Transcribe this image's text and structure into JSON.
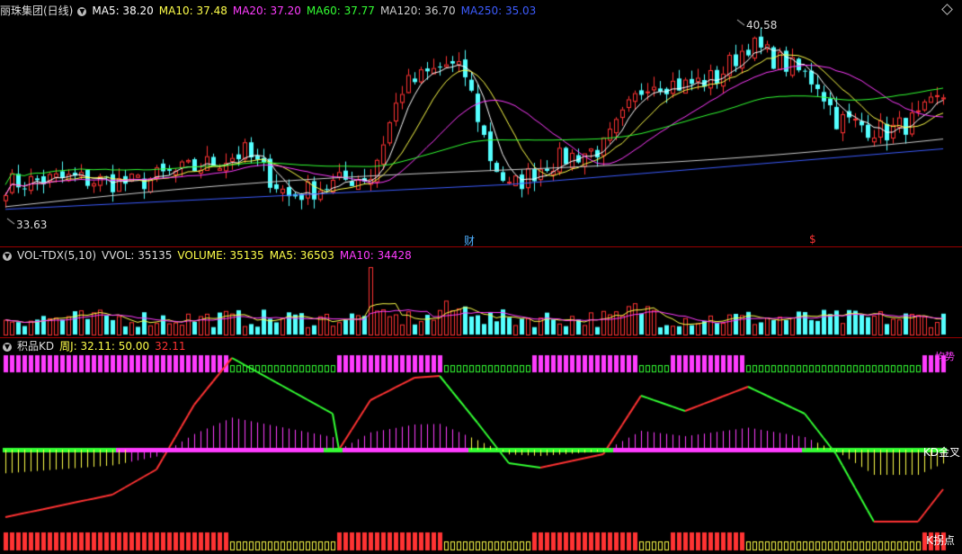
{
  "main": {
    "title": "丽珠集团(日线)",
    "ma": [
      {
        "label": "MA5: 38.20",
        "color": "#ffffff"
      },
      {
        "label": "MA10: 37.48",
        "color": "#ffff4a"
      },
      {
        "label": "MA20: 37.20",
        "color": "#ff3cff"
      },
      {
        "label": "MA60: 37.77",
        "color": "#33ff33"
      },
      {
        "label": "MA120: 36.70",
        "color": "#cccccc"
      },
      {
        "label": "MA250: 35.03",
        "color": "#3d5cff"
      }
    ],
    "high_label": "40.58",
    "low_label": "33.63",
    "markers": [
      {
        "label": "财",
        "color": "#4fb0ff"
      },
      {
        "label": "$",
        "color": "#ff3333"
      }
    ]
  },
  "volume": {
    "title": "VOL-TDX(5,10)",
    "fields": [
      {
        "label": "VVOL: 35135",
        "color": "#dddddd"
      },
      {
        "label": "VOLUME: 35135",
        "color": "#ffff4a"
      },
      {
        "label": "MA5: 36503",
        "color": "#ffff4a"
      },
      {
        "label": "MA10: 34428",
        "color": "#ff3cff"
      }
    ]
  },
  "kd": {
    "title": "积品KD",
    "fields": [
      {
        "label": "周J: 32.11",
        "color": "#ffff4a"
      },
      {
        "label": ": 50.00",
        "color": "#ffff4a"
      },
      {
        "label": "32.11",
        "color": "#ff3333"
      }
    ],
    "labels": {
      "top_right": "均势",
      "mid_right": "KD金叉",
      "bottom_right": "K拐点"
    }
  },
  "colors": {
    "up": "#ff3333",
    "down": "#54ffff",
    "magenta": "#ff3cff",
    "green": "#33ff33",
    "yellow": "#ffff4a",
    "divider": "#9a0000"
  }
}
